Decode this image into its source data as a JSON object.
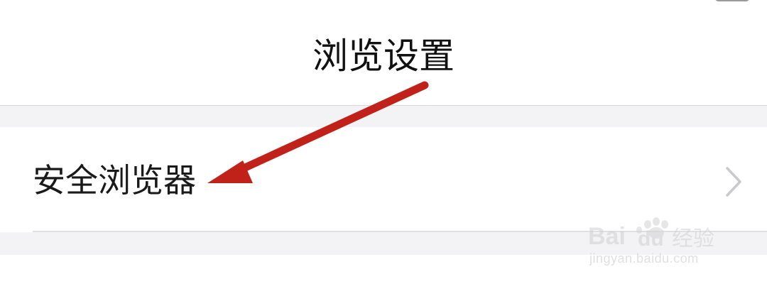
{
  "nav": {
    "title": "浏览设置"
  },
  "settings": {
    "items": [
      {
        "label": "安全浏览器"
      }
    ]
  },
  "watermark": {
    "brand": "Baidu经验",
    "url": "jingyan.baidu.com"
  },
  "colors": {
    "background": "#ffffff",
    "section_gap": "#f3f3f6",
    "arrow": "#c0221a",
    "title_text": "#111111",
    "chevron": "#c9c9ce"
  },
  "icons": {
    "row_trailing": "chevron-right-icon",
    "annotation": "arrow-annotation-icon"
  }
}
